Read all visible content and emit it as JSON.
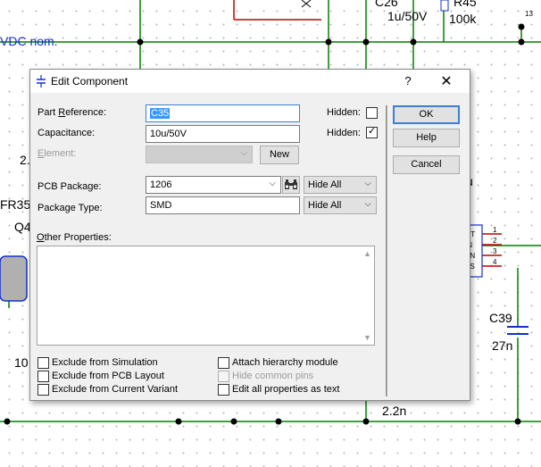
{
  "schematic": {
    "labels": {
      "c26": "C26",
      "c26_value": "1u/50V",
      "r45": "R45",
      "r45_value": "100k",
      "pin13": "13",
      "vdc_note": "VDC nom.",
      "left_2": "2.",
      "fr35": "FR35",
      "q4": "Q4",
      "u_label": "u",
      "ic_pins": [
        "OT",
        "IN",
        "EN",
        "SS"
      ],
      "pin_numbers": [
        "1",
        "2",
        "3",
        "4"
      ],
      "c39": "C39",
      "c39_value": "27n",
      "left_10": "10",
      "bottom_value": "2.2n"
    },
    "colors": {
      "wire": "#008000",
      "ic_border": "#1030d0",
      "pin": "#c00000",
      "note": "#1030d0"
    }
  },
  "dialog": {
    "title": "Edit Component",
    "help_glyph": "?",
    "close_glyph": "✕",
    "part_reference": {
      "label": "Part Reference:",
      "value": "C35"
    },
    "capacitance": {
      "label": "Capacitance:",
      "value": "10u/50V"
    },
    "element": {
      "label": "Element:",
      "value": ""
    },
    "new_button": "New",
    "pcb_package": {
      "label": "PCB Package:",
      "value": "1206",
      "visibility": "Hide All"
    },
    "package_type": {
      "label": "Package Type:",
      "value": "SMD",
      "visibility": "Hide All"
    },
    "hidden_label_1": "Hidden:",
    "hidden_label_2": "Hidden:",
    "hidden_1_checked": false,
    "hidden_2_checked": true,
    "other_properties_label": "Other Properties:",
    "buttons": {
      "ok": "OK",
      "help": "Help",
      "cancel": "Cancel"
    },
    "checkboxes": {
      "exclude_simulation": "Exclude from Simulation",
      "exclude_pcb": "Exclude from PCB Layout",
      "exclude_variant": "Exclude from Current Variant",
      "attach_hierarchy": "Attach hierarchy module",
      "hide_common_pins": "Hide common pins",
      "edit_all_text": "Edit all properties as text"
    }
  }
}
